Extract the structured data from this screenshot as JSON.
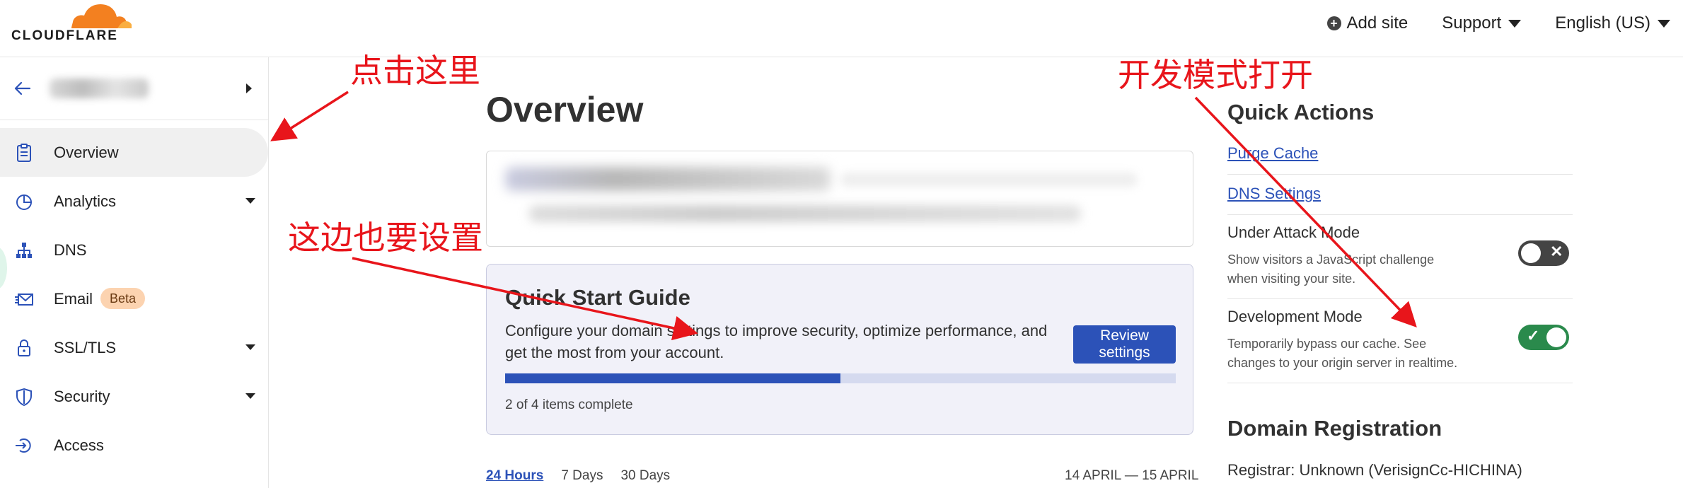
{
  "brand": {
    "name": "CLOUDFLARE",
    "cloud_color": "#f38020"
  },
  "topbar": {
    "add_site": "Add site",
    "support": "Support",
    "language": "English (US)"
  },
  "sidebar": {
    "items": [
      {
        "label": "Overview",
        "icon": "clipboard-icon",
        "active": true
      },
      {
        "label": "Analytics",
        "icon": "pie-chart-icon",
        "has_submenu": true
      },
      {
        "label": "DNS",
        "icon": "network-icon"
      },
      {
        "label": "Email",
        "icon": "envelope-icon",
        "badge": "Beta"
      },
      {
        "label": "SSL/TLS",
        "icon": "lock-icon",
        "has_submenu": true
      },
      {
        "label": "Security",
        "icon": "shield-icon",
        "has_submenu": true
      },
      {
        "label": "Access",
        "icon": "access-icon"
      }
    ]
  },
  "main": {
    "title": "Overview",
    "quick_start": {
      "title": "Quick Start Guide",
      "description": "Configure your domain settings to improve security, optimize performance, and get the most from your account.",
      "button": "Review settings",
      "progress_fraction": 0.5,
      "status": "2 of 4 items complete"
    },
    "time_tabs": [
      "24 Hours",
      "7 Days",
      "30 Days"
    ],
    "active_tab": "24 Hours",
    "date_range": "14 APRIL — 15 APRIL"
  },
  "quick_actions": {
    "title": "Quick Actions",
    "links": [
      "Purge Cache",
      "DNS Settings"
    ],
    "under_attack": {
      "title": "Under Attack Mode",
      "description": "Show visitors a JavaScript challenge when visiting your site.",
      "enabled": false
    },
    "dev_mode": {
      "title": "Development Mode",
      "description": "Temporarily bypass our cache. See changes to your origin server in realtime.",
      "enabled": true
    }
  },
  "domain_registration": {
    "title": "Domain Registration",
    "registrar": "Registrar: Unknown (VerisignCc-HICHINA)"
  },
  "annotations": {
    "click_here": "点击这里",
    "also_set_here": "这边也要设置",
    "dev_mode_on": "开发模式打开",
    "color": "#e8151b"
  },
  "colors": {
    "accent_blue": "#2c52b8",
    "toggle_on": "#2a8a4c",
    "toggle_off": "#444444",
    "qsg_background": "#f1f1f9"
  }
}
